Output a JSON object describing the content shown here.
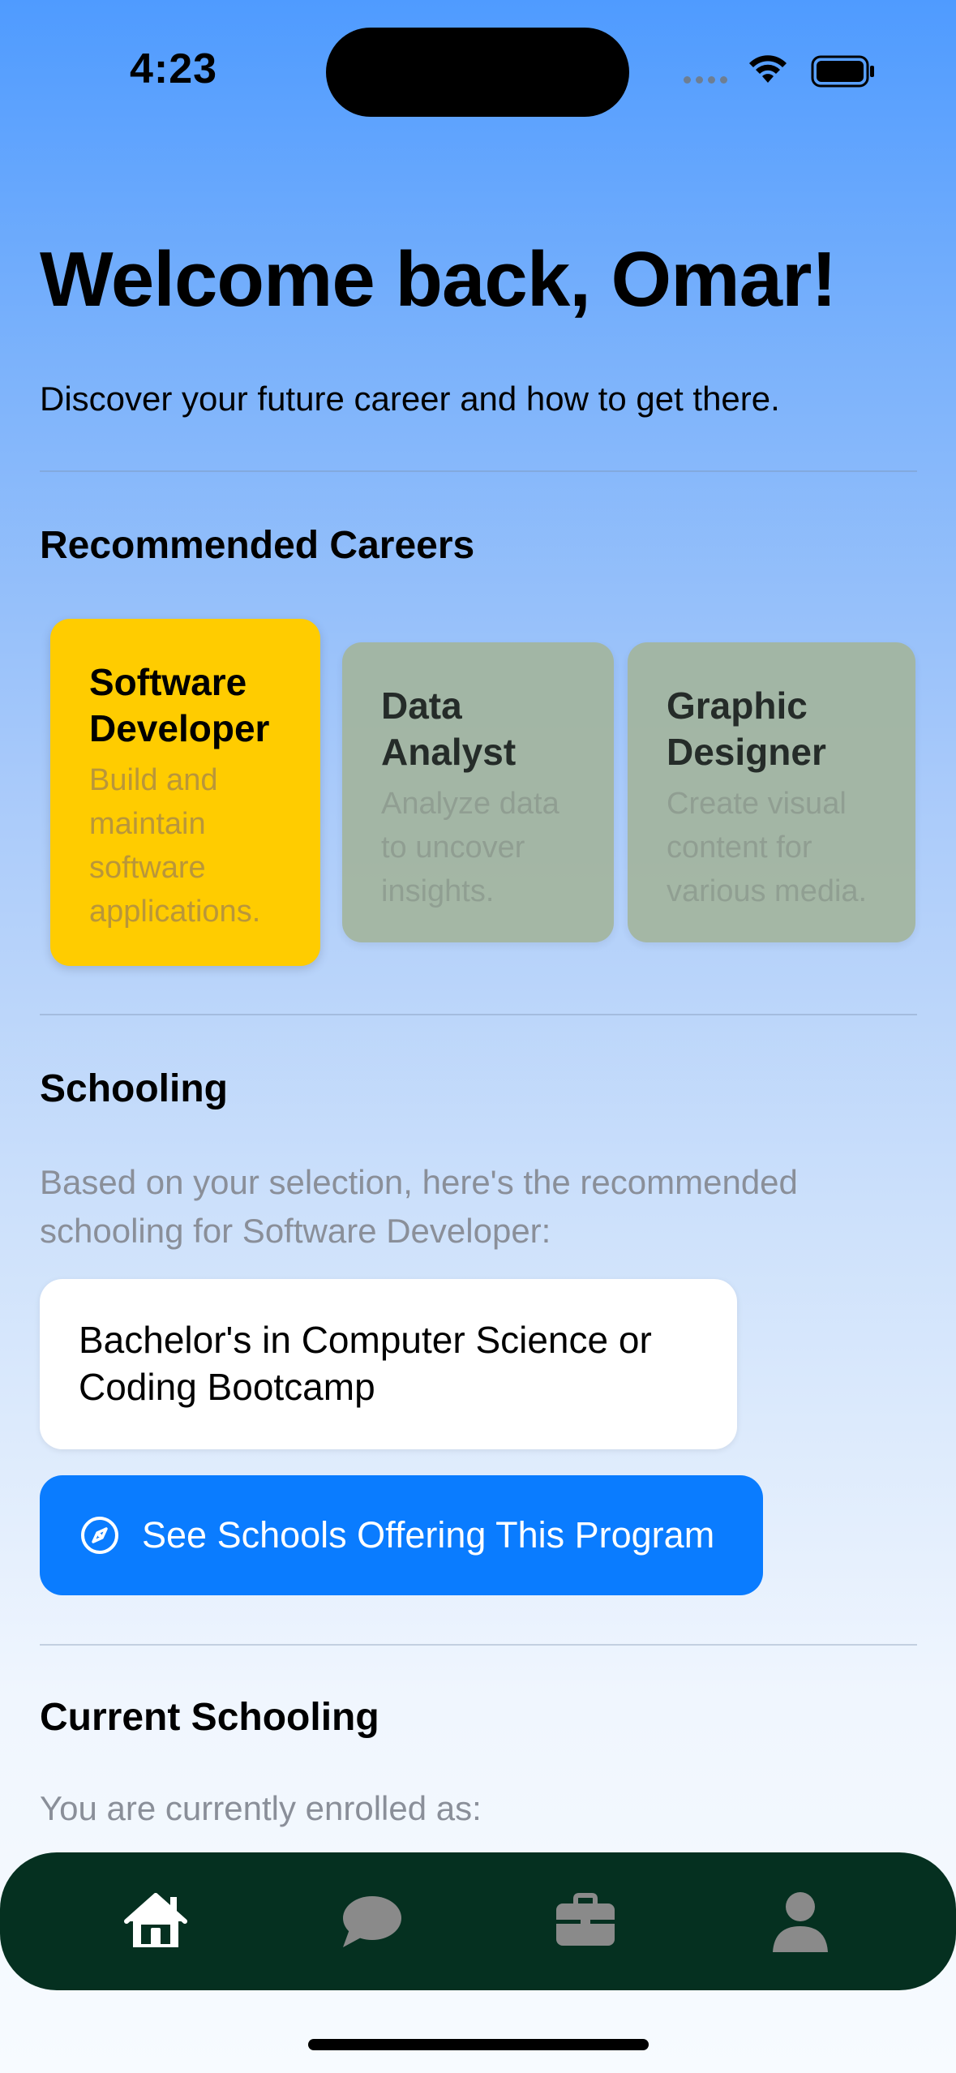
{
  "status_bar": {
    "time": "4:23"
  },
  "header": {
    "title": "Welcome back, Omar!",
    "subtitle": "Discover your future career and how to get there."
  },
  "careers": {
    "section_title": "Recommended Careers",
    "items": [
      {
        "name": "Software Developer",
        "description": "Build and maintain software applications.",
        "selected": true
      },
      {
        "name": "Data Analyst",
        "description": "Analyze data to uncover insights.",
        "selected": false
      },
      {
        "name": "Graphic Designer",
        "description": "Create visual content for various media.",
        "selected": false
      }
    ]
  },
  "schooling": {
    "section_title": "Schooling",
    "description": "Based on your selection, here's the recommended schooling for Software Developer:",
    "program": "Bachelor's in Computer Science or Coding Bootcamp",
    "cta_label": "See Schools Offering This Program",
    "cta_icon": "compass-icon"
  },
  "current_schooling": {
    "section_title": "Current Schooling",
    "description": "You are currently enrolled as:"
  },
  "tabbar": {
    "tabs": [
      {
        "icon": "home-icon",
        "active": true
      },
      {
        "icon": "chat-bubble-icon",
        "active": false
      },
      {
        "icon": "briefcase-icon",
        "active": false
      },
      {
        "icon": "person-icon",
        "active": false
      }
    ]
  },
  "colors": {
    "accent": "#0a7cff",
    "selected_card": "#ffcc00",
    "tabbar_bg": "#053020",
    "tab_active": "#ffffff",
    "tab_inactive": "#8a8a8a"
  }
}
